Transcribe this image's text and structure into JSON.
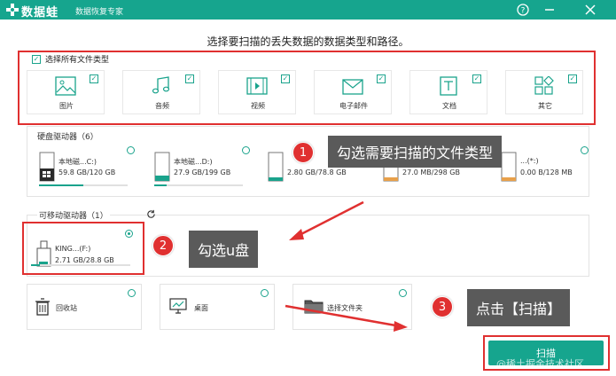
{
  "app": {
    "name": "数据蛙",
    "subtitle": "数据恢复专家"
  },
  "prompt": "选择要扫描的丢失数据的数据类型和路径。",
  "select_all_label": "选择所有文件类型",
  "file_types": [
    {
      "label": "图片",
      "icon": "image-icon",
      "checked": true
    },
    {
      "label": "音频",
      "icon": "music-icon",
      "checked": true
    },
    {
      "label": "视频",
      "icon": "video-icon",
      "checked": true
    },
    {
      "label": "电子邮件",
      "icon": "mail-icon",
      "checked": true
    },
    {
      "label": "文档",
      "icon": "document-icon",
      "checked": true
    },
    {
      "label": "其它",
      "icon": "other-icon",
      "checked": true
    }
  ],
  "hard_drives": {
    "title": "硬盘驱动器（6）",
    "items": [
      {
        "name": "本地磁...C:)",
        "size": "59.8 GB/120 GB",
        "usage": 0.5
      },
      {
        "name": "本地磁...D:)",
        "size": "27.9 GB/199 GB",
        "usage": 0.14
      },
      {
        "name": "",
        "size": "2.80 GB/78.8 GB",
        "usage": 0.04
      },
      {
        "name": "",
        "size": "27.0 MB/298 GB",
        "usage": 0.01
      },
      {
        "name": "...(*:)",
        "size": "0.00 B/128 MB",
        "usage": 0.0
      }
    ]
  },
  "removable": {
    "title": "可移动驱动器（1）",
    "items": [
      {
        "name": "KING...(F:)",
        "size": "2.71 GB/28.8 GB",
        "usage": 0.09,
        "selected": true
      }
    ]
  },
  "locations": [
    {
      "label": "回收站",
      "icon": "trash-icon"
    },
    {
      "label": "桌面",
      "icon": "desktop-icon"
    },
    {
      "label": "选择文件夹",
      "icon": "folder-icon"
    }
  ],
  "scan_button": "扫描",
  "callouts": [
    {
      "num": "1",
      "text": "勾选需要扫描的文件类型"
    },
    {
      "num": "2",
      "text": "勾选u盘"
    },
    {
      "num": "3",
      "text": "点击【扫描】"
    }
  ],
  "watermark": "@稀土掘金技术社区",
  "colors": {
    "accent": "#16a58e",
    "highlight": "#e03030",
    "callout_bg": "#5a5a5a"
  }
}
